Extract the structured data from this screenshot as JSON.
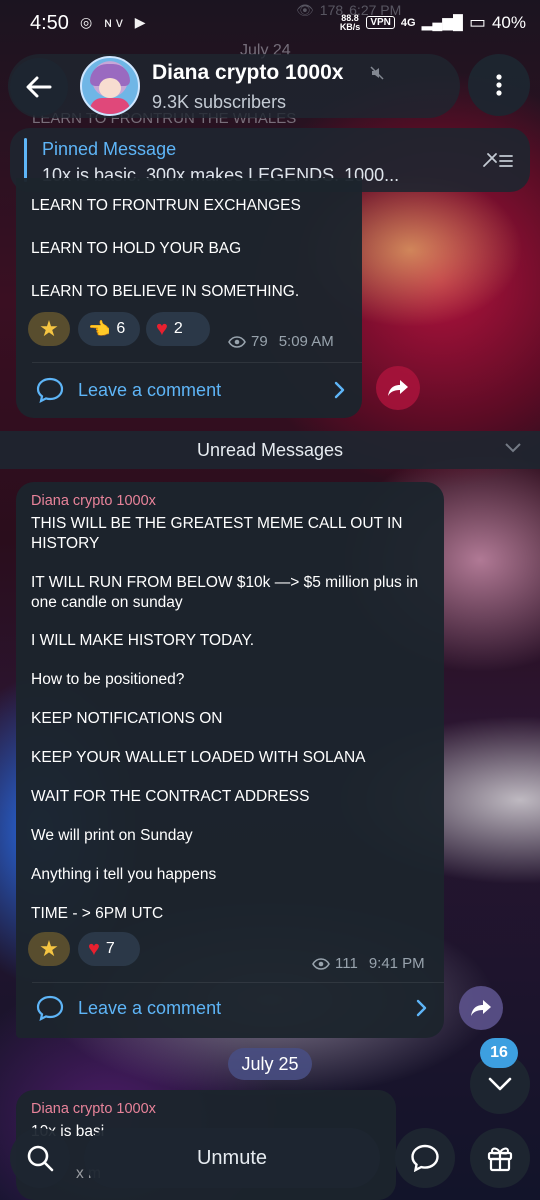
{
  "status_bar": {
    "time": "4:50",
    "speed": "88.8",
    "speed_unit": "KB/s",
    "vpn": "VPN",
    "network": "4G",
    "battery": "40%"
  },
  "header": {
    "title": "Diana crypto 1000x",
    "subtitle": "9.3K subscribers"
  },
  "background_text": {
    "views_top": "178",
    "time_top": "6:27 PM",
    "date_top": "July 24",
    "frontrun_whales": "LEARN TO FRONTRUN THE WHALES"
  },
  "pinned": {
    "title": "Pinned Message",
    "text": "10x is basic.  300x makes LEGENDS.  1000..."
  },
  "message1": {
    "lines": [
      "LEARN TO FRONTRUN EXCHANGES",
      "LEARN TO HOLD YOUR BAG",
      "LEARN TO BELIEVE IN SOMETHING."
    ],
    "reactions": [
      {
        "icon": "star-icon",
        "count": ""
      },
      {
        "icon": "pointing-hand-icon",
        "count": "6"
      },
      {
        "icon": "heart-icon",
        "count": "2"
      }
    ],
    "views": "79",
    "time": "5:09 AM",
    "comment_label": "Leave a comment"
  },
  "unread_label": "Unread Messages",
  "message2": {
    "author": "Diana crypto 1000x",
    "lines": [
      "THIS WILL BE THE GREATEST MEME CALL OUT IN HISTORY",
      "IT WILL RUN FROM BELOW $10k —> $5 million plus in one candle on sunday",
      "I WILL MAKE HISTORY TODAY.",
      "How to be positioned?",
      "KEEP NOTIFICATIONS ON",
      "KEEP YOUR WALLET LOADED WITH SOLANA",
      "WAIT FOR THE CONTRACT ADDRESS",
      "We will print on Sunday",
      "Anything i tell you happens",
      "TIME - > 6PM UTC"
    ],
    "reactions": [
      {
        "icon": "star-icon",
        "count": ""
      },
      {
        "icon": "heart-icon",
        "count": "7"
      }
    ],
    "views": "111",
    "time": "9:41 PM",
    "comment_label": "Leave a comment"
  },
  "date_pill": "July 25",
  "message3": {
    "author": "Diana crypto 1000x",
    "text_partial": "10x is basi",
    "text_partial2": "x m"
  },
  "scroll_badge": "16",
  "bottom": {
    "unmute_label": "Unmute"
  },
  "colors": {
    "accent": "#5eb5f7",
    "author": "#e8839a",
    "bubble": "#1c242d",
    "date_pill": "#484e82",
    "badge": "#3d9fe0"
  }
}
